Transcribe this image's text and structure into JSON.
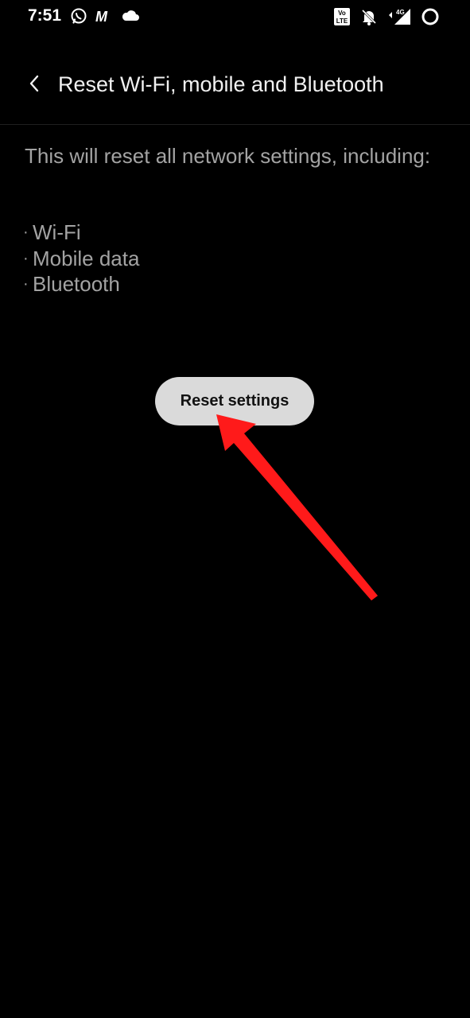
{
  "status_bar": {
    "time": "7:51",
    "left_icons": [
      "whatsapp-icon",
      "m-app-icon",
      "cloud-icon"
    ],
    "right_icons": [
      "volte-icon",
      "notifications-off-icon",
      "signal-4g-icon",
      "battery-ring-icon"
    ],
    "volte_text": [
      "Vo",
      "LTE"
    ],
    "network_label": "4G",
    "m_label": "M"
  },
  "header": {
    "back_icon": "chevron-left-icon",
    "title": "Reset Wi-Fi, mobile and Bluetooth"
  },
  "content": {
    "description": "This will reset all network settings, including:",
    "items": [
      "Wi-Fi",
      "Mobile data",
      "Bluetooth"
    ],
    "bullet": "·"
  },
  "actions": {
    "reset_label": "Reset settings"
  },
  "colors": {
    "background": "#000000",
    "text_primary": "#f1f1f1",
    "text_secondary": "#a3a3a3",
    "button_bg": "#dadada",
    "arrow": "#ff1a1a"
  }
}
